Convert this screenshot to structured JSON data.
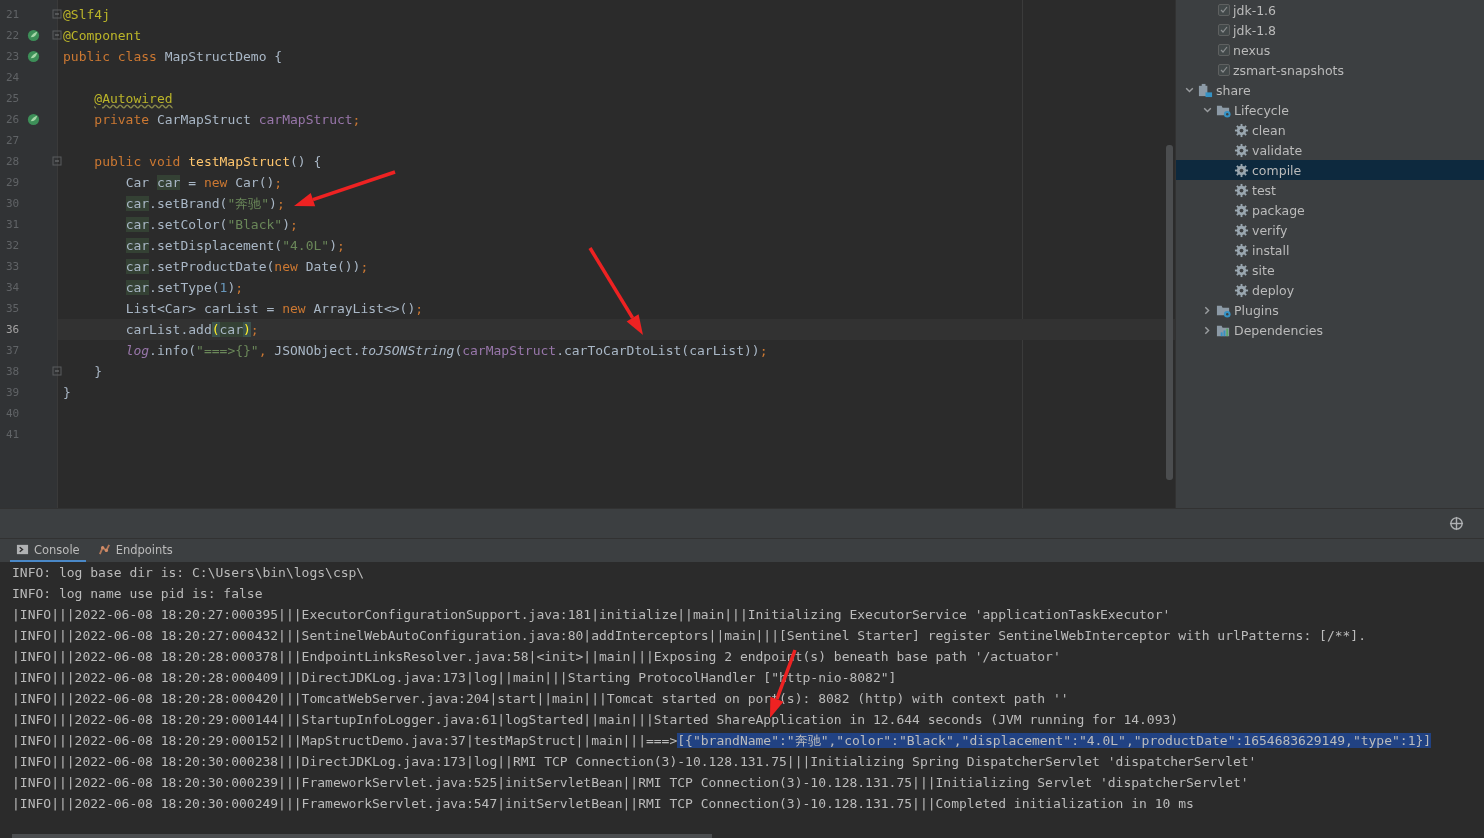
{
  "editor": {
    "lines": [
      {
        "num": "21",
        "current": false,
        "fold": true,
        "bean": false,
        "tokens": [
          {
            "t": "@Slf4j",
            "kind": "ann"
          }
        ]
      },
      {
        "num": "22",
        "current": false,
        "fold": true,
        "bean": true,
        "tokens": [
          {
            "t": "@Component",
            "kind": "ann"
          }
        ]
      },
      {
        "num": "23",
        "current": false,
        "fold": false,
        "bean": true,
        "tokens": [
          {
            "t": "public class",
            "kind": "kw"
          },
          {
            "t": " MapStructDemo {",
            "kind": "plain"
          }
        ]
      },
      {
        "num": "24",
        "current": false,
        "fold": false,
        "bean": false
      },
      {
        "num": "25",
        "current": false,
        "fold": false,
        "bean": false,
        "tokens": [
          {
            "t": "    @Autowired",
            "kind": "ann-warn"
          }
        ]
      },
      {
        "num": "26",
        "current": false,
        "fold": false,
        "bean": true,
        "tokens": [
          {
            "t": "    private",
            "kind": "kw"
          },
          {
            "t": " CarMapStruct ",
            "kind": "plain"
          },
          {
            "t": "carMapStruct",
            "kind": "field"
          },
          {
            "t": ";",
            "kind": "kw"
          }
        ]
      },
      {
        "num": "27",
        "current": false,
        "fold": false,
        "bean": false
      },
      {
        "num": "28",
        "current": false,
        "fold": true,
        "bean": false,
        "tokens": [
          {
            "t": "    public void",
            "kind": "kw"
          },
          {
            "t": " testMapStruct",
            "kind": "method"
          },
          {
            "t": "() {",
            "kind": "plain"
          }
        ]
      },
      {
        "num": "29",
        "current": false,
        "fold": false,
        "bean": false,
        "tokens": [
          {
            "t": "        Car ",
            "kind": "plain"
          },
          {
            "t": "car",
            "kind": "usage"
          },
          {
            "t": " = ",
            "kind": "plain"
          },
          {
            "t": "new",
            "kind": "kw"
          },
          {
            "t": " Car()",
            "kind": "plain"
          },
          {
            "t": ";",
            "kind": "kw"
          }
        ]
      },
      {
        "num": "30",
        "current": false,
        "fold": false,
        "bean": false,
        "tokens": [
          {
            "t": "        car",
            "kind": "usage"
          },
          {
            "t": ".setBrand(",
            "kind": "plain"
          },
          {
            "t": "\"奔驰\"",
            "kind": "str"
          },
          {
            "t": ")",
            "kind": "plain"
          },
          {
            "t": ";",
            "kind": "kw"
          }
        ]
      },
      {
        "num": "31",
        "current": false,
        "fold": false,
        "bean": false,
        "tokens": [
          {
            "t": "        car",
            "kind": "usage"
          },
          {
            "t": ".setColor(",
            "kind": "plain"
          },
          {
            "t": "\"Black\"",
            "kind": "str"
          },
          {
            "t": ")",
            "kind": "plain"
          },
          {
            "t": ";",
            "kind": "kw"
          }
        ]
      },
      {
        "num": "32",
        "current": false,
        "fold": false,
        "bean": false,
        "tokens": [
          {
            "t": "        car",
            "kind": "usage"
          },
          {
            "t": ".setDisplacement(",
            "kind": "plain"
          },
          {
            "t": "\"4.0L\"",
            "kind": "str"
          },
          {
            "t": ")",
            "kind": "plain"
          },
          {
            "t": ";",
            "kind": "kw"
          }
        ]
      },
      {
        "num": "33",
        "current": false,
        "fold": false,
        "bean": false,
        "tokens": [
          {
            "t": "        car",
            "kind": "usage"
          },
          {
            "t": ".setProductDate(",
            "kind": "plain"
          },
          {
            "t": "new",
            "kind": "kw"
          },
          {
            "t": " Date())",
            "kind": "plain"
          },
          {
            "t": ";",
            "kind": "kw"
          }
        ]
      },
      {
        "num": "34",
        "current": false,
        "fold": false,
        "bean": false,
        "tokens": [
          {
            "t": "        car",
            "kind": "usage"
          },
          {
            "t": ".setType(",
            "kind": "plain"
          },
          {
            "t": "1",
            "kind": "num"
          },
          {
            "t": ")",
            "kind": "plain"
          },
          {
            "t": ";",
            "kind": "kw"
          }
        ]
      },
      {
        "num": "35",
        "current": false,
        "fold": false,
        "bean": false,
        "tokens": [
          {
            "t": "        List<Car> carList = ",
            "kind": "plain"
          },
          {
            "t": "new",
            "kind": "kw"
          },
          {
            "t": " ArrayList<>()",
            "kind": "plain"
          },
          {
            "t": ";",
            "kind": "kw"
          }
        ]
      },
      {
        "num": "36",
        "current": true,
        "fold": false,
        "bean": false,
        "tokens": [
          {
            "t": "        carList.add",
            "kind": "plain"
          },
          {
            "t": "(",
            "kind": "brace"
          },
          {
            "t": "car",
            "kind": "usage"
          },
          {
            "t": ")",
            "kind": "brace"
          },
          {
            "t": ";",
            "kind": "kw"
          }
        ]
      },
      {
        "num": "37",
        "current": false,
        "fold": false,
        "bean": false,
        "tokens": [
          {
            "t": "        log",
            "kind": "static-field"
          },
          {
            "t": ".info(",
            "kind": "plain"
          },
          {
            "t": "\"===>{}\"",
            "kind": "str"
          },
          {
            "t": ",",
            "kind": "kw"
          },
          {
            "t": " JSONObject.",
            "kind": "plain"
          },
          {
            "t": "toJSONString",
            "kind": "static"
          },
          {
            "t": "(",
            "kind": "plain"
          },
          {
            "t": "carMapStruct",
            "kind": "field"
          },
          {
            "t": ".carToCarDtoList(carList))",
            "kind": "plain"
          },
          {
            "t": ";",
            "kind": "kw"
          }
        ]
      },
      {
        "num": "38",
        "current": false,
        "fold": true,
        "bean": false,
        "tokens": [
          {
            "t": "    }",
            "kind": "plain"
          }
        ]
      },
      {
        "num": "39",
        "current": false,
        "fold": false,
        "bean": false,
        "tokens": [
          {
            "t": "}",
            "kind": "plain"
          }
        ]
      },
      {
        "num": "40",
        "current": false,
        "fold": false,
        "bean": false
      },
      {
        "num": "41",
        "current": false,
        "fold": false,
        "bean": false
      }
    ]
  },
  "maven": {
    "profiles": [
      {
        "label": "jdk-1.6",
        "checked": true
      },
      {
        "label": "jdk-1.8",
        "checked": true
      },
      {
        "label": "nexus",
        "checked": true
      },
      {
        "label": "zsmart-snapshots",
        "checked": true
      }
    ],
    "tree": [
      {
        "label": "share",
        "kind": "module",
        "expanded": true,
        "selected": false,
        "children": [
          {
            "label": "Lifecycle",
            "kind": "folder",
            "expanded": true,
            "selected": false,
            "children": [
              {
                "label": "clean",
                "kind": "goal",
                "selected": false
              },
              {
                "label": "validate",
                "kind": "goal",
                "selected": false
              },
              {
                "label": "compile",
                "kind": "goal",
                "selected": true
              },
              {
                "label": "test",
                "kind": "goal",
                "selected": false
              },
              {
                "label": "package",
                "kind": "goal",
                "selected": false
              },
              {
                "label": "verify",
                "kind": "goal",
                "selected": false
              },
              {
                "label": "install",
                "kind": "goal",
                "selected": false
              },
              {
                "label": "site",
                "kind": "goal",
                "selected": false
              },
              {
                "label": "deploy",
                "kind": "goal",
                "selected": false
              }
            ]
          },
          {
            "label": "Plugins",
            "kind": "folder",
            "expanded": false,
            "selected": false
          },
          {
            "label": "Dependencies",
            "kind": "deps",
            "expanded": false,
            "selected": false
          }
        ]
      }
    ]
  },
  "bottom_tabs": [
    {
      "label": "Console",
      "kind": "console",
      "selected": true
    },
    {
      "label": "Endpoints",
      "kind": "endpoints",
      "selected": false
    }
  ],
  "console": {
    "lines": [
      {
        "text": "INFO: log base dir is: C:\\Users\\bin\\logs\\csp\\"
      },
      {
        "text": "INFO: log name use pid is: false"
      },
      {
        "text": "|INFO|||2022-06-08 18:20:27:000395|||ExecutorConfigurationSupport.java:181|initialize||main|||Initializing ExecutorService 'applicationTaskExecutor'"
      },
      {
        "text": "|INFO|||2022-06-08 18:20:27:000432|||SentinelWebAutoConfiguration.java:80|addInterceptors||main|||[Sentinel Starter] register SentinelWebInterceptor with urlPatterns: [/**]."
      },
      {
        "text": "|INFO|||2022-06-08 18:20:28:000378|||EndpointLinksResolver.java:58|<init>||main|||Exposing 2 endpoint(s) beneath base path '/actuator'"
      },
      {
        "text": "|INFO|||2022-06-08 18:20:28:000409|||DirectJDKLog.java:173|log||main|||Starting ProtocolHandler [\"http-nio-8082\"]"
      },
      {
        "text": "|INFO|||2022-06-08 18:20:28:000420|||TomcatWebServer.java:204|start||main|||Tomcat started on port(s): 8082 (http) with context path ''"
      },
      {
        "text": "|INFO|||2022-06-08 18:20:29:000144|||StartupInfoLogger.java:61|logStarted||main|||Started ShareApplication in 12.644 seconds (JVM running for 14.093)"
      },
      {
        "text": "|INFO|||2022-06-08 18:20:29:000152|||MapStructDemo.java:37|testMapStruct||main|||===>",
        "selection": "[{\"brandName\":\"奔驰\",\"color\":\"Black\",\"displacement\":\"4.0L\",\"productDate\":1654683629149,\"type\":1}]"
      },
      {
        "text": "|INFO|||2022-06-08 18:20:30:000238|||DirectJDKLog.java:173|log||RMI TCP Connection(3)-10.128.131.75|||Initializing Spring DispatcherServlet 'dispatcherServlet'"
      },
      {
        "text": "|INFO|||2022-06-08 18:20:30:000239|||FrameworkServlet.java:525|initServletBean||RMI TCP Connection(3)-10.128.131.75|||Initializing Servlet 'dispatcherServlet'"
      },
      {
        "text": "|INFO|||2022-06-08 18:20:30:000249|||FrameworkServlet.java:547|initServletBean||RMI TCP Connection(3)-10.128.131.75|||Completed initialization in 10 ms"
      }
    ]
  }
}
